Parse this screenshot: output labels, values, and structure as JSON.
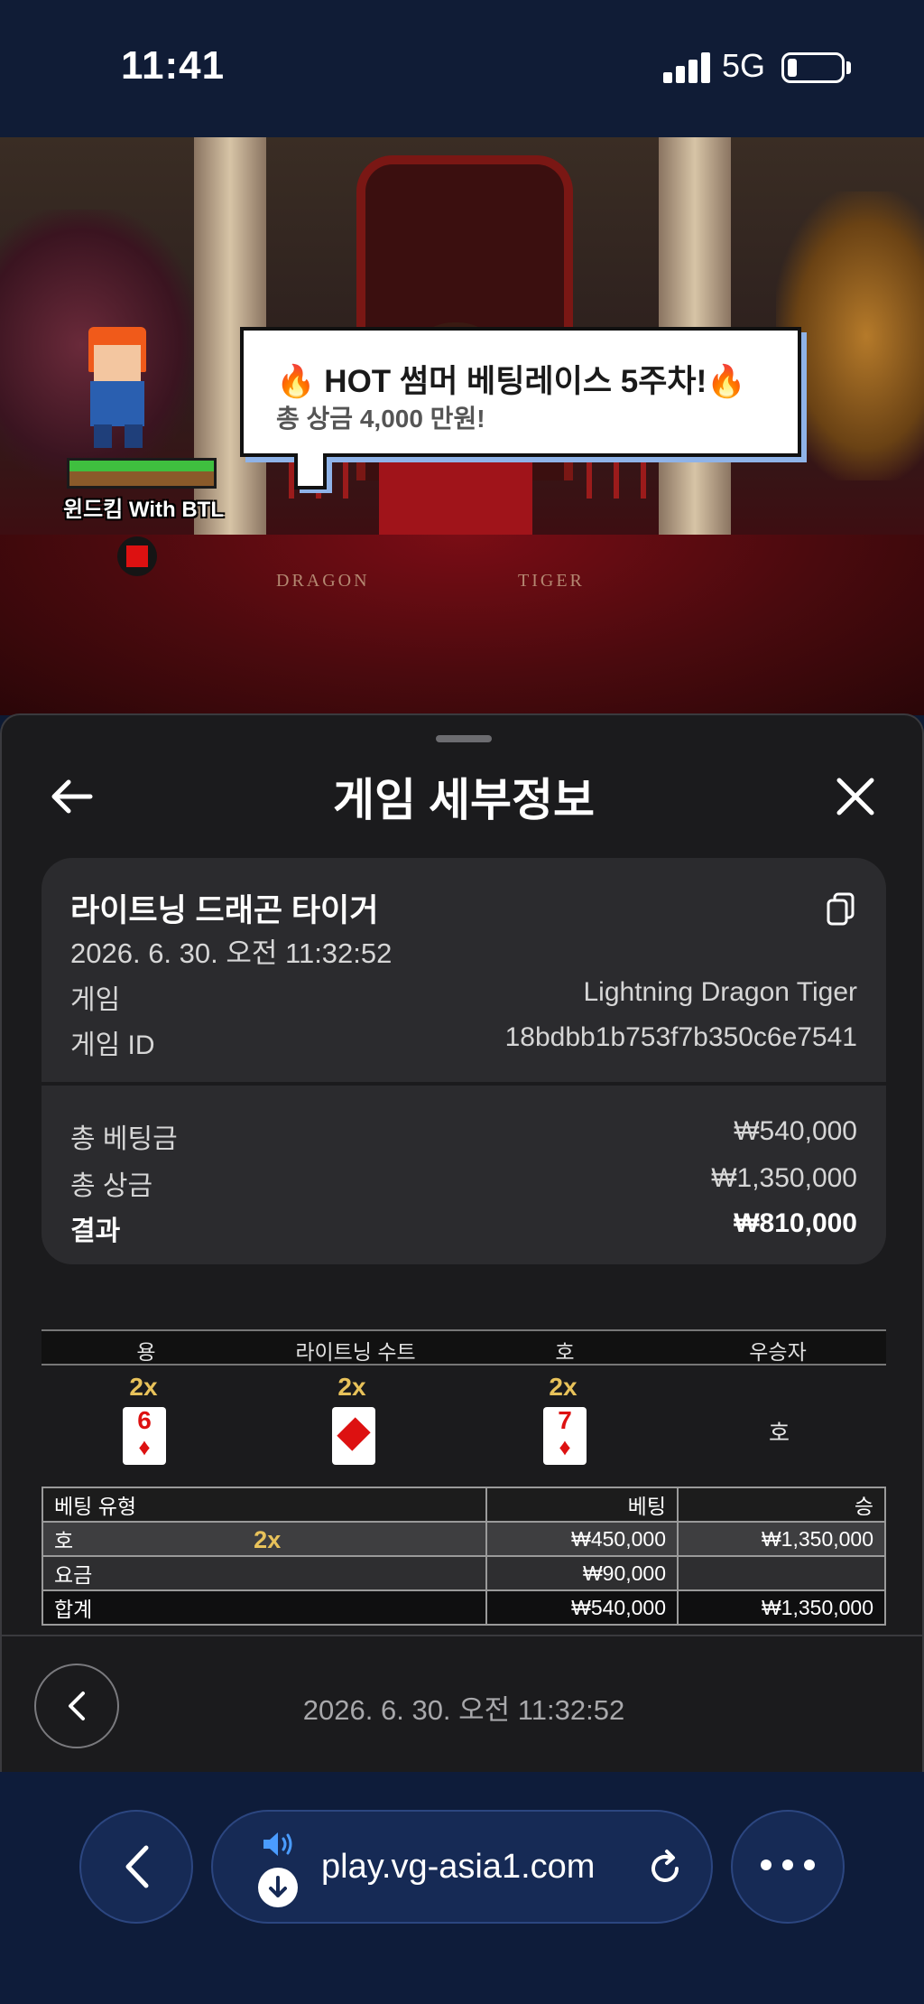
{
  "status_bar": {
    "time": "11:41",
    "network": "5G"
  },
  "video": {
    "banner_title": "🔥 HOT 썸머 베팅레이스 5주차!🔥",
    "banner_subtitle": "총 상금 4,000 만원!",
    "mascot_name": "윈드킴 With BTL",
    "table_left": "DRAGON",
    "table_right": "TIGER"
  },
  "sheet": {
    "title": "게임 세부정보",
    "game_name": "라이트닝 드래곤 타이거",
    "datetime": "2026. 6. 30. 오전 11:32:52",
    "info": [
      {
        "label": "게임",
        "value": "Lightning Dragon Tiger"
      },
      {
        "label": "게임 ID",
        "value": "18bdbb1b753f7b350c6e7541"
      }
    ],
    "totals": [
      {
        "label": "총 베팅금",
        "value": "₩540,000"
      },
      {
        "label": "총 상금",
        "value": "₩1,350,000"
      },
      {
        "label": "결과",
        "value": "₩810,000"
      }
    ],
    "result": {
      "headers": [
        "용",
        "라이트닝 수트",
        "호",
        "우승자"
      ],
      "dragon": {
        "multiplier": "2x",
        "rank": "6",
        "suit": "♦"
      },
      "lightning_suit": {
        "multiplier": "2x",
        "suit": "♦"
      },
      "tiger": {
        "multiplier": "2x",
        "rank": "7",
        "suit": "♦"
      },
      "winner": "호"
    },
    "bet_table": {
      "headers": [
        "베팅 유형",
        "베팅",
        "승"
      ],
      "rows": [
        {
          "type": "호",
          "multiplier": "2x",
          "bet": "₩450,000",
          "win": "₩1,350,000"
        },
        {
          "type": "요금",
          "bet": "₩90,000",
          "win": ""
        },
        {
          "type": "합계",
          "bet": "₩540,000",
          "win": "₩1,350,000"
        }
      ]
    },
    "footer_datetime": "2026. 6. 30. 오전 11:32:52"
  },
  "browser": {
    "url": "play.vg-asia1.com"
  }
}
